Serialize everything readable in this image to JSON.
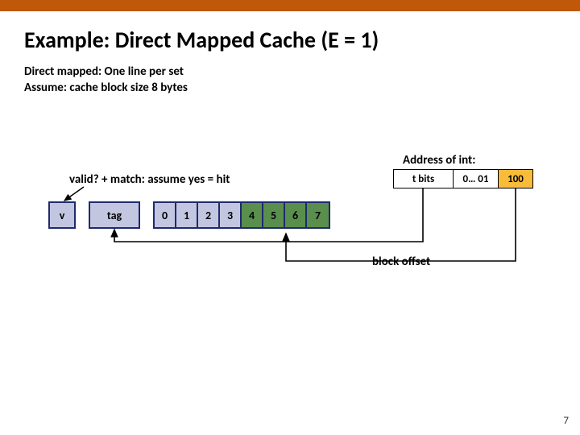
{
  "title": "Example: Direct Mapped Cache (E = 1)",
  "subtitle_line1": "Direct mapped: One line per set",
  "subtitle_line2": "Assume: cache block size 8 bytes",
  "address": {
    "label": "Address of int:",
    "tbits": "t bits",
    "set": "0… 01",
    "offset": "100"
  },
  "valid_line": "valid?   +   match: assume yes = hit",
  "cache": {
    "v": "v",
    "tag": "tag",
    "bytes": [
      "0",
      "1",
      "2",
      "3",
      "4",
      "5",
      "6",
      "7"
    ],
    "hit_start": 4,
    "hit_end": 7
  },
  "block_offset_label": "block offset",
  "page_number": "7",
  "colors": {
    "accent_bar": "#c0580a",
    "cell_fill": "#c3c6e0",
    "cell_border": "#1e2a6e",
    "hit_fill": "#598e4c",
    "offset_fill": "#f8bb3a"
  }
}
